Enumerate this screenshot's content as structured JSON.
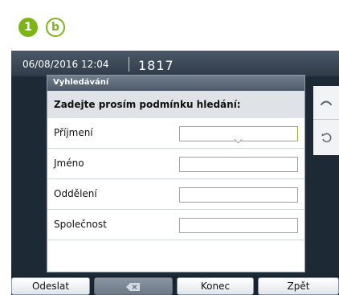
{
  "badges": {
    "step": "1",
    "variant": "b"
  },
  "colors": {
    "accent": "#7cb518",
    "screen_bg": "#1e2936"
  },
  "status_bar": {
    "datetime": "06/08/2016 12:04",
    "extension": "1817"
  },
  "dialog": {
    "title": "Vyhledávání",
    "header": "Zadejte prosím podmínku hledání:",
    "fields": [
      {
        "label": "Příjmení",
        "value": "",
        "active": true
      },
      {
        "label": "Jméno",
        "value": ""
      },
      {
        "label": "Oddělení",
        "value": ""
      },
      {
        "label": "Společnost",
        "value": ""
      }
    ]
  },
  "side_buttons": [
    {
      "icon": "handset-icon",
      "glyph": "⌒"
    },
    {
      "icon": "back-icon",
      "glyph": "↶"
    }
  ],
  "softkeys": {
    "send": "Odeslat",
    "backspace_icon": "backspace-icon",
    "end": "Konec",
    "back": "Zpět"
  }
}
